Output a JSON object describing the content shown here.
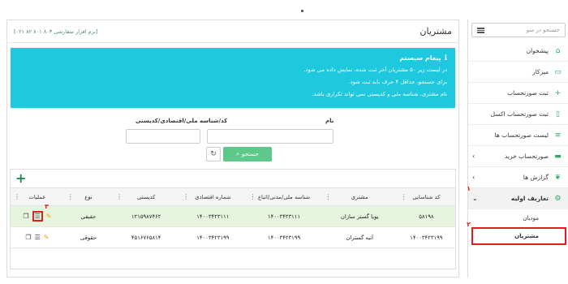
{
  "sidebar": {
    "search_placeholder": "جستجو در منو",
    "items": [
      {
        "label": "پیشخوان",
        "icon": "home-icon",
        "chevron": false
      },
      {
        "label": "میزکار",
        "icon": "monitor-icon",
        "chevron": false
      },
      {
        "label": "ثبت صورتحساب",
        "icon": "plus-icon",
        "chevron": false
      },
      {
        "label": "ثبت صورتحساب اکسل",
        "icon": "document-icon",
        "chevron": false
      },
      {
        "label": "لیست صورتحساب ها",
        "icon": "list-icon",
        "chevron": false
      },
      {
        "label": "صورتحساب خرید",
        "icon": "card-icon",
        "chevron": true
      },
      {
        "label": "گزارش ها",
        "icon": "leaf-icon",
        "chevron": true
      },
      {
        "label": "تعاریف اولیه",
        "icon": "gears-icon",
        "chevron": true,
        "expanded": true
      }
    ],
    "subitems": [
      "مودیان",
      "مشتریان"
    ],
    "markers": [
      "۱",
      "۲"
    ]
  },
  "header": {
    "title": "مشتریان",
    "phone": "[نرم افزار سفارشی ۸۰۳ ۸۰۱ ۸۲ ۰۲۱]"
  },
  "alert": {
    "title": "پیغام سیستم",
    "lines": [
      "در لیست زیر ۵۰ مشتریان آخر ثبت شده، نمایش داده می شود.",
      "برای جستجو، حداقل ۴ حرف باید ثبت شود.",
      "نام مشتری، شناسه ملی و کدپستی نمی تواند تکراری باشد."
    ]
  },
  "form": {
    "name_label": "نام",
    "code_label": "کد/شناسه ملی/اقتصادی/کدپستی",
    "search_button": "جستجو"
  },
  "table": {
    "headers": [
      "کد شناسایی",
      "مشتری",
      "شناسه ملی/مدنی/اتباع",
      "شماره اقتصادی",
      "کدپستی",
      "نوع",
      "عملیات"
    ],
    "rows": [
      [
        "۵۸۱۹۸",
        "پویا گستر سازان",
        "۱۴۰۰۳۴۲۳۱۱۱",
        "۱۴۰۰۳۴۲۳۱۱۱",
        "۱۲۱۵۹۸۷۴۶۲",
        "حقیقی"
      ],
      [
        "۱۴۰۰۳۴۲۳۱۹۹",
        "آتیه گستران",
        "۱۴۰۰۳۴۲۳۱۹۹",
        "۱۴۰۰۳۴۲۳۱۹۹",
        "۴۵۱۶۷۶۵۸۱۴",
        "حقوقی"
      ]
    ],
    "marker": "۳"
  },
  "colors": {
    "accent": "#27ae60",
    "alert": "#1ec8de",
    "highlight": "#e7f4de",
    "callout": "#e02020"
  }
}
